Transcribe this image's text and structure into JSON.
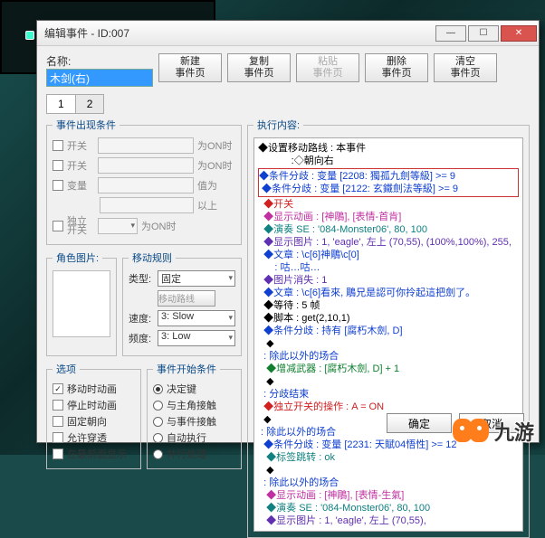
{
  "dialog": {
    "title": "编辑事件 - ID:007",
    "name_label": "名称:",
    "name_value": "木剑(右)"
  },
  "toolbar": {
    "new": "新建\n事件页",
    "copy": "复制\n事件页",
    "paste": "粘贴\n事件页",
    "delete": "删除\n事件页",
    "clear": "清空\n事件页"
  },
  "tabs": {
    "t1": "1",
    "t2": "2"
  },
  "conditions": {
    "legend": "事件出现条件",
    "sw1_label": "开关",
    "sw1_suffix": "为ON时",
    "sw2_label": "开关",
    "sw2_suffix": "为ON时",
    "var_label": "变量",
    "var_suffix": "值为",
    "var_gte": "以上",
    "selfsw_label": "独立\n开关",
    "selfsw_suffix": "为ON时"
  },
  "charpic": {
    "legend": "角色图片:"
  },
  "moverule": {
    "legend": "移动规则",
    "type_label": "类型:",
    "type_value": "固定",
    "route_btn": "移动路线",
    "speed_label": "速度:",
    "speed_value": "3: Slow",
    "freq_label": "频度:",
    "freq_value": "3: Low"
  },
  "options": {
    "legend": "选项",
    "o1": "移动时动画",
    "o1_on": true,
    "o2": "停止时动画",
    "o2_on": false,
    "o3": "固定朝向",
    "o3_on": false,
    "o4": "允许穿透",
    "o4_on": false,
    "o5": "在最前面显示",
    "o5_on": false
  },
  "startcond": {
    "legend": "事件开始条件",
    "r1": "决定键",
    "r1_on": true,
    "r2": "与主角接触",
    "r2_on": false,
    "r3": "与事件接触",
    "r3_on": false,
    "r4": "自动执行",
    "r4_on": false,
    "r5": "并行处理",
    "r5_on": false
  },
  "exec": {
    "legend": "执行内容:",
    "lines": [
      {
        "cls": "c-black",
        "text": "◆设置移动路线 : 本事件"
      },
      {
        "cls": "c-black",
        "text": "            :◇朝向右"
      },
      {
        "boxstart": true
      },
      {
        "cls": "c-blue",
        "text": "◆条件分歧 : 变量 [2208: 獨孤九劍等級] >= 9"
      },
      {
        "cls": "c-blue",
        "text": " ◆条件分歧 : 变量 [2122: 玄鐵劍法等級] >= 9"
      },
      {
        "boxend": true
      },
      {
        "cls": "c-red",
        "text": "  ◆开关"
      },
      {
        "cls": "c-pink",
        "text": "  ◆显示动画 : [神鵰], [表情-首肯]"
      },
      {
        "cls": "c-teal",
        "text": "  ◆演奏 SE : '084-Monster06', 80, 100"
      },
      {
        "cls": "c-purple",
        "text": "  ◆显示图片 : 1, 'eagle', 左上 (70,55), (100%,100%), 255,"
      },
      {
        "cls": "c-blue",
        "text": "  ◆文章 : \\c[6]神鵰\\c[0]"
      },
      {
        "cls": "c-blue",
        "text": "      : 咕…咕…"
      },
      {
        "cls": "c-purple",
        "text": "  ◆图片消失 : 1"
      },
      {
        "cls": "c-blue",
        "text": "  ◆文章 : \\c[6]看來, 鵰兄是認可你拎起這把劍了。"
      },
      {
        "cls": "c-black",
        "text": "  ◆等待 : 5 帧"
      },
      {
        "cls": "c-black",
        "text": "  ◆脚本 : get(2,10,1)"
      },
      {
        "cls": "c-blue",
        "text": "  ◆条件分歧 : 持有 [腐朽木劍, D]"
      },
      {
        "cls": "c-black",
        "text": "   ◆"
      },
      {
        "cls": "c-blue",
        "text": "  : 除此以外的场合"
      },
      {
        "cls": "c-green",
        "text": "   ◆增减武器 : [腐朽木劍, D] + 1"
      },
      {
        "cls": "c-black",
        "text": "   ◆"
      },
      {
        "cls": "c-blue",
        "text": "  : 分歧结束"
      },
      {
        "cls": "c-red",
        "text": "  ◆独立开关的操作 : A = ON"
      },
      {
        "cls": "c-black",
        "text": "  ◆"
      },
      {
        "cls": "c-blue",
        "text": " : 除此以外的场合"
      },
      {
        "cls": "c-blue",
        "text": "  ◆条件分歧 : 变量 [2231: 天賦04悟性] >= 12"
      },
      {
        "cls": "c-teal",
        "text": "   ◆标签跳转 : ok"
      },
      {
        "cls": "c-black",
        "text": "   ◆"
      },
      {
        "cls": "c-blue",
        "text": "  : 除此以外的场合"
      },
      {
        "cls": "c-pink",
        "text": "   ◆显示动画 : [神鵰], [表情-生氣]"
      },
      {
        "cls": "c-teal",
        "text": "   ◆演奏 SE : '084-Monster06', 80, 100"
      },
      {
        "cls": "c-purple",
        "text": "   ◆显示图片 : 1, 'eagle', 左上 (70,55),"
      }
    ]
  },
  "buttons": {
    "ok": "确定",
    "cancel": "取消"
  },
  "brand": {
    "text": "九游"
  }
}
